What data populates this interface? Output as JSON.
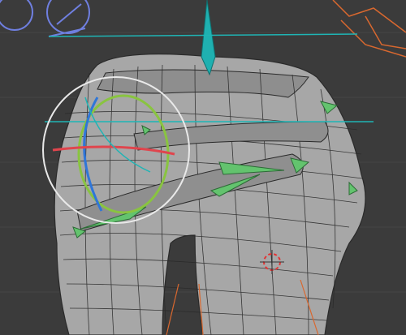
{
  "viewport": {
    "label": "",
    "background": "#3b3b3b",
    "grid_color": "#454545"
  },
  "mesh": {
    "fill": "#a7a7a7",
    "wire": "#2a2a2a",
    "shade": "#7f7f7f"
  },
  "bones": {
    "selected_color": "#1fb0b0",
    "bone_color": "#63c36e",
    "dark_bone_color": "#2c6a36"
  },
  "gizmo": {
    "ring_color": "#e9e9e9",
    "x_axis_color": "#e0454d",
    "y_axis_color": "#89c440",
    "z_axis_color": "#2f76d8",
    "view_axis_color": "#1fb5b5"
  },
  "overlays": {
    "cursor_color": "#e23434",
    "orange_wire_color": "#d9682f",
    "blue_controls_color": "#6f7fe0",
    "icons": [
      "rotate-gizmo-icon",
      "3d-cursor-icon",
      "bone-icon"
    ]
  }
}
